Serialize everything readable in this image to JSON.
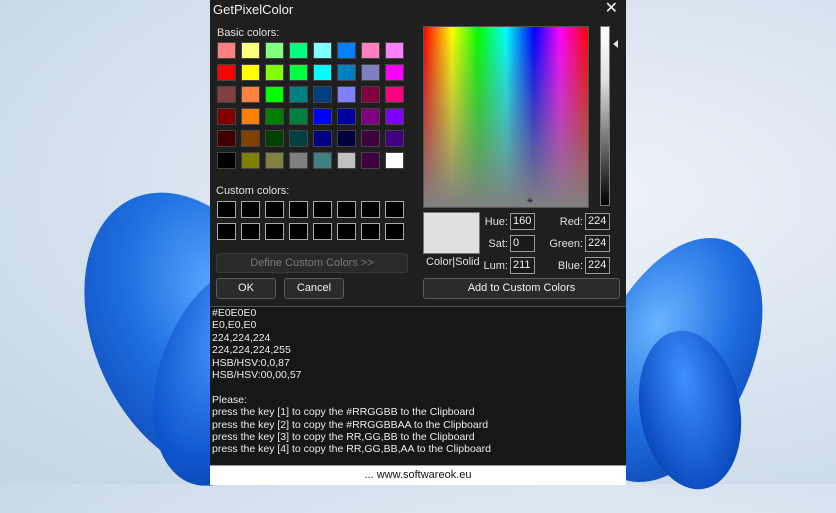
{
  "window": {
    "title": "GetPixelColor",
    "close_glyph": "✕"
  },
  "basic_colors": {
    "label": "Basic colors:",
    "swatches": [
      "#ff8080",
      "#ffff80",
      "#80ff80",
      "#00ff80",
      "#80ffff",
      "#0080ff",
      "#ff80c0",
      "#ff80ff",
      "#ff0000",
      "#ffff00",
      "#80ff00",
      "#00ff40",
      "#00ffff",
      "#0080c0",
      "#8080c0",
      "#ff00ff",
      "#804040",
      "#ff8040",
      "#00ff00",
      "#008080",
      "#004080",
      "#8080ff",
      "#800040",
      "#ff0080",
      "#800000",
      "#ff8000",
      "#008000",
      "#008040",
      "#0000ff",
      "#0000a0",
      "#800080",
      "#8000ff",
      "#400000",
      "#804000",
      "#004000",
      "#004040",
      "#000080",
      "#000040",
      "#400040",
      "#400080",
      "#000000",
      "#808000",
      "#808040",
      "#808080",
      "#408080",
      "#c0c0c0",
      "#400040",
      "#ffffff"
    ]
  },
  "custom_colors": {
    "label": "Custom colors:",
    "count": 16
  },
  "buttons": {
    "define": "Define Custom Colors >>",
    "ok": "OK",
    "cancel": "Cancel",
    "add": "Add to Custom Colors"
  },
  "picker": {
    "color_solid_label": "Color|Solid",
    "preview_color": "#e0e0e0",
    "hue_label": "Hue:",
    "hue": "160",
    "sat_label": "Sat:",
    "sat": "0",
    "lum_label": "Lum:",
    "lum": "211",
    "red_label": "Red:",
    "red": "224",
    "green_label": "Green:",
    "green": "224",
    "blue_label": "Blue:",
    "blue": "224"
  },
  "output": {
    "lines": [
      "#E0E0E0",
      "E0,E0,E0",
      "224,224,224",
      "224,224,224,255",
      "HSB/HSV:0,0,87",
      "HSB/HSV:00,00,57",
      "",
      "Please:",
      "press the key [1] to copy the #RRGGBB to the Clipboard",
      "press the key [2] to copy the #RRGGBBAA to the Clipboard",
      "press the key [3] to copy the RR,GG,BB to the Clipboard",
      "press the key [4] to copy the RR,GG,BB,AA to the Clipboard"
    ]
  },
  "status": {
    "link": "...  www.softwareok.eu"
  }
}
